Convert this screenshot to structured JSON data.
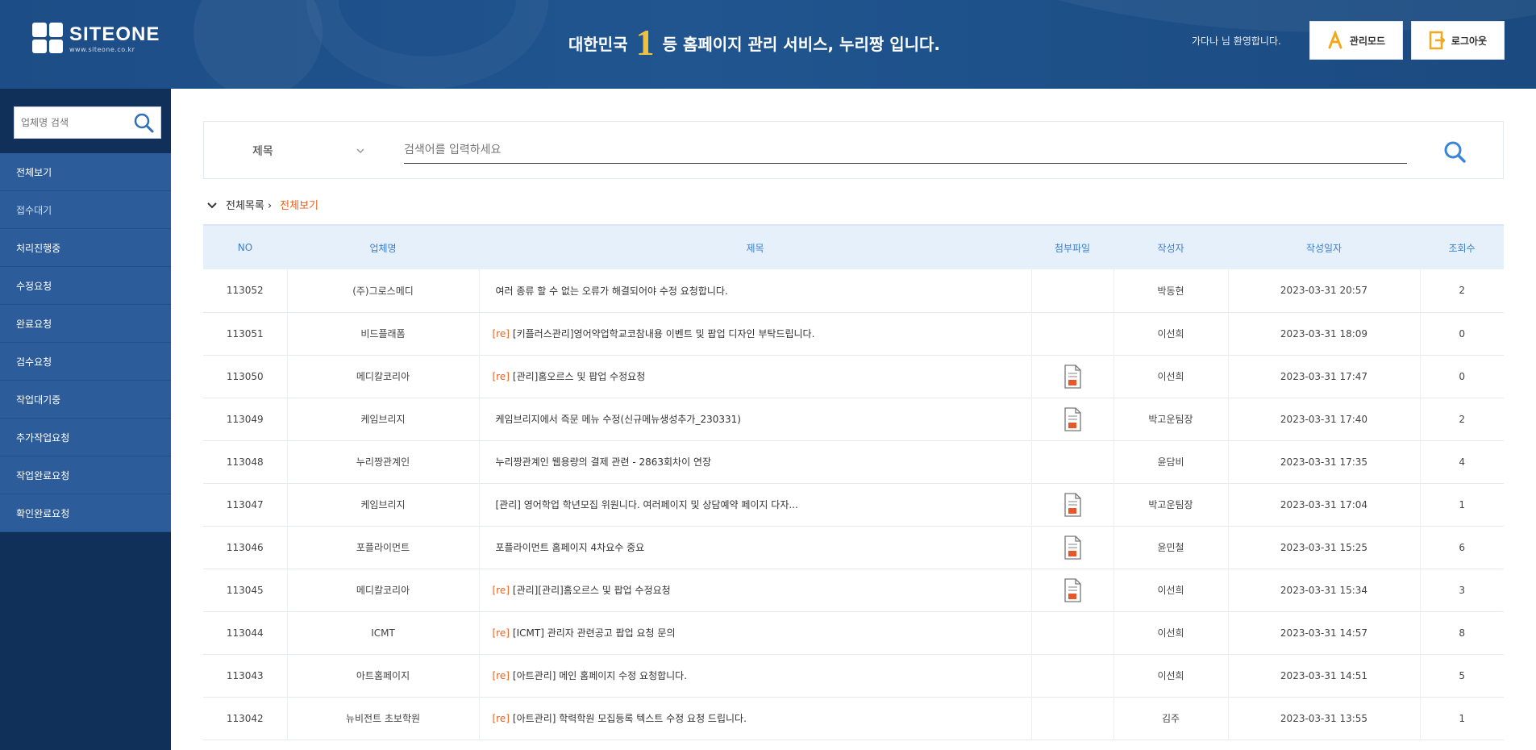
{
  "header": {
    "logo_name": "SITEONE",
    "logo_sub": "www.siteone.co.kr",
    "slogan_prefix": "대한민국",
    "slogan_rank": "1",
    "slogan_suffix": "등 홈페이지 관리 서비스, 누리짱 입니다.",
    "notice": "가다나 님 환영합니다.",
    "admin_button": "관리모드",
    "logout_button": "로그아웃",
    "colors": {
      "bg": "#1d4d86",
      "accent": "#f0c040"
    }
  },
  "sidebar": {
    "search_placeholder": "업체명 검색",
    "search_icon": "search-icon",
    "items": [
      {
        "label": "전체보기"
      },
      {
        "label": "접수대기"
      },
      {
        "label": "처리진행중"
      },
      {
        "label": "수정요청"
      },
      {
        "label": "완료요청"
      },
      {
        "label": "검수요청"
      },
      {
        "label": "작업대기중"
      },
      {
        "label": "추가작업요청"
      },
      {
        "label": "작업완료요청"
      },
      {
        "label": "확인완료요청"
      }
    ],
    "active_index": 1
  },
  "search": {
    "select_value": "제목",
    "input_placeholder": "검색어를 입력하세요",
    "search_icon": "search-icon"
  },
  "crumb": {
    "label": "전체목록 ›",
    "link": "전체보기"
  },
  "table": {
    "columns": [
      "NO",
      "업체명",
      "제목",
      "첨부파일",
      "작성자",
      "작성일자",
      "조회수"
    ],
    "rows": [
      {
        "no": "113052",
        "company": "(주)그로스메디",
        "tag": "",
        "title": "여러 종류 할 수 없는 오류가 해결되어야 수정 요청합니다.",
        "file": false,
        "author": "박동현",
        "date": "2023-03-31 20:57",
        "views": "2"
      },
      {
        "no": "113051",
        "company": "비드플래폼",
        "tag": "[re]",
        "title": "[키플러스관리]영어약업학교코참내용 이벤트 및 팝업 디자인 부탁드립니다.",
        "file": false,
        "author": "이선희",
        "date": "2023-03-31 18:09",
        "views": "0"
      },
      {
        "no": "113050",
        "company": "메디칼코리아",
        "tag": "[re]",
        "title": "[관리]홈오르스 및 팝업 수정요청",
        "file": true,
        "author": "이선희",
        "date": "2023-03-31 17:47",
        "views": "0"
      },
      {
        "no": "113049",
        "company": "케임브리지",
        "tag": "",
        "title": "케임브리지에서 즉문 메뉴 수정(신규메뉴생성추가_230331)",
        "file": true,
        "author": "박고운팀장",
        "date": "2023-03-31 17:40",
        "views": "2"
      },
      {
        "no": "113048",
        "company": "누리짱관계인",
        "tag": "",
        "title": "누리짱관계인 웹용량의 결제 관련 - 2863회차이 연장",
        "file": false,
        "author": "윤담비",
        "date": "2023-03-31 17:35",
        "views": "4"
      },
      {
        "no": "113047",
        "company": "케임브리지",
        "tag": "",
        "title": "[관리] 영어학업 학년모집 위원니다. 여러페이지 및 상담예약 페이지 다자...",
        "file": true,
        "author": "박고운팀장",
        "date": "2023-03-31 17:04",
        "views": "1"
      },
      {
        "no": "113046",
        "company": "포플라이먼트",
        "tag": "",
        "title": "포플라이먼트 홈페이지 4차요수 중요",
        "file": true,
        "author": "윤민철",
        "date": "2023-03-31 15:25",
        "views": "6"
      },
      {
        "no": "113045",
        "company": "메디칼코리아",
        "tag": "[re]",
        "title": "[관리][관리]홈오르스 및 팝업 수정요청",
        "file": true,
        "author": "이선희",
        "date": "2023-03-31 15:34",
        "views": "3"
      },
      {
        "no": "113044",
        "company": "ICMT",
        "tag": "[re]",
        "title": "[ICMT] 관리자 관련공고 팝업 요청 문의",
        "file": false,
        "author": "이선희",
        "date": "2023-03-31 14:57",
        "views": "8"
      },
      {
        "no": "113043",
        "company": "아트홈페이지",
        "tag": "[re]",
        "title": "[아트관리] 메인 홈페이지 수정 요청합니다.",
        "file": false,
        "author": "이선희",
        "date": "2023-03-31 14:51",
        "views": "5"
      },
      {
        "no": "113042",
        "company": "뉴비전트 초보학원",
        "tag": "[re]",
        "title": "[아트관리] 학력학원 모집등록 텍스트 수정 요청 드립니다.",
        "file": false,
        "author": "김주",
        "date": "2023-03-31 13:55",
        "views": "1"
      }
    ],
    "colors": {
      "header_bg": "#e6f0fb",
      "header_text": "#3b7fd0",
      "tag": "#f0601a"
    }
  }
}
